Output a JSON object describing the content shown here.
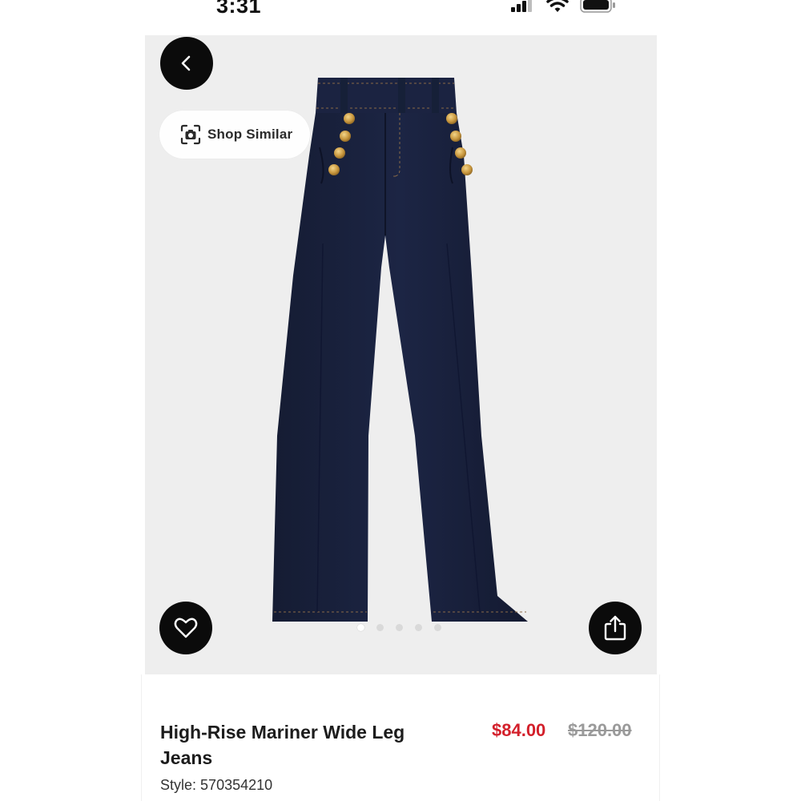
{
  "status_bar": {
    "time": "3:31"
  },
  "hero": {
    "shop_similar_label": "Shop Similar",
    "image_count": 5,
    "active_image": 0
  },
  "product": {
    "title": "High-Rise Mariner Wide Leg Jeans",
    "sale_price": "$84.00",
    "original_price": "$120.00",
    "style_label": "Style:",
    "style_number": "570354210"
  },
  "colors": {
    "price_sale": "#d3202b",
    "button_bg": "#0b0b0b",
    "denim": "#1a2340"
  },
  "icons": {
    "back": "chevron-left-icon",
    "shop_similar": "camera-scan-icon",
    "like": "heart-icon",
    "share": "share-icon"
  }
}
